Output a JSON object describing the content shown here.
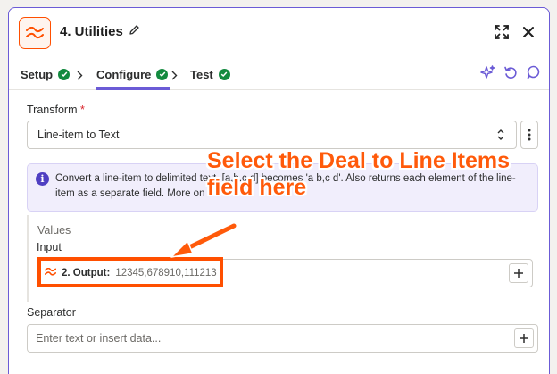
{
  "header": {
    "title": "4. Utilities",
    "icons": {
      "app": "utilities-icon",
      "edit": "pencil-icon",
      "expand": "expand-icon",
      "close": "close-icon"
    }
  },
  "tabs": [
    {
      "label": "Setup",
      "complete": true
    },
    {
      "label": "Configure",
      "complete": true,
      "active": true
    },
    {
      "label": "Test",
      "complete": true
    }
  ],
  "toolbar": {
    "icons": [
      "sparkle-icon",
      "undo-icon",
      "comment-icon"
    ]
  },
  "transform": {
    "label": "Transform",
    "required_mark": "*",
    "value": "Line-item to Text"
  },
  "info": {
    "text": "Convert a line-item to delimited text. [a,b,c,d] becomes 'a b,c d'. Also returns each element of the line-item as a separate field. More on"
  },
  "values": {
    "title": "Values",
    "input_label": "Input",
    "input_pill": {
      "name": "2. Output:",
      "value": "12345,678910,111213"
    }
  },
  "separator": {
    "label": "Separator",
    "placeholder": "Enter text or insert data..."
  },
  "annotation": {
    "text": "Select the Deal to Line Items field here"
  },
  "colors": {
    "accent": "#6b5bd6",
    "brand": "#ff4f00",
    "success": "#138a3f",
    "annotation": "#ff5a0a"
  }
}
